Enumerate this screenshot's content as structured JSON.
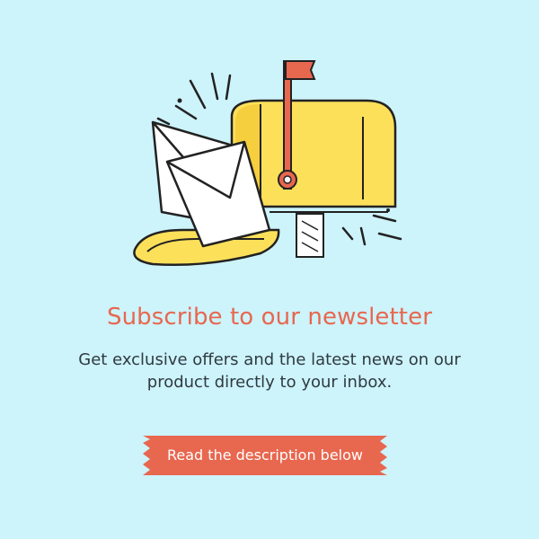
{
  "newsletter": {
    "title": "Subscribe to our newsletter",
    "description": "Get exclusive offers and the latest news on our product directly to your inbox.",
    "cta_label": "Read the description below"
  },
  "colors": {
    "background": "#cdf3fb",
    "accent": "#e8674f",
    "mailbox_yellow": "#fde05a",
    "text": "#2f3a40"
  },
  "icons": {
    "illustration": "mailbox-with-envelopes-icon"
  }
}
